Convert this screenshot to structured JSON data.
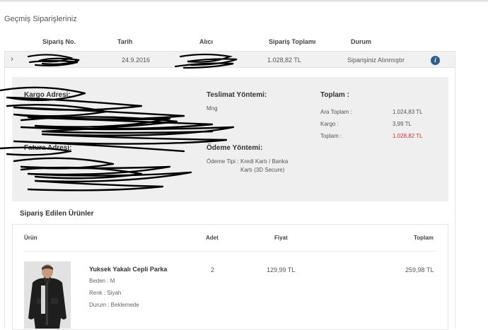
{
  "page": {
    "title": "Geçmiş Siparişleriniz"
  },
  "orders_table": {
    "headers": {
      "order_no": "Sipariş No.",
      "date": "Tarih",
      "recipient": "Alıcı",
      "order_total": "Sipariş Toplamı",
      "status": "Durum"
    },
    "row": {
      "date": "24.9.2016",
      "total": "1.028,82 TL",
      "status": "Siparişiniz Alınmıştır"
    }
  },
  "details": {
    "shipping_address_title": "Kargo Adresi:",
    "billing_address_title": "Fatura Adresi:",
    "delivery_method_title": "Teslimat Yöntemi:",
    "delivery_method_value": "Mng",
    "payment_method_title": "Ödeme Yöntemi:",
    "payment_type_label": "Ödeme Tipi :",
    "payment_type_value_1": "Kredi Kartı / Banka",
    "payment_type_value_2": "Kartı (3D Secure)",
    "totals": {
      "title": "Toplam :",
      "subtotal_label": "Ara Toplam :",
      "subtotal_value": "1.024,83 TL",
      "shipping_label": "Kargo :",
      "shipping_value": "3,99 TL",
      "total_label": "Toplam :",
      "total_value": "1.028,82 TL",
      "total_color": "#d9322c"
    }
  },
  "products": {
    "title": "Sipariş Edilen Ürünler",
    "headers": {
      "product": "Ürün",
      "quantity": "Adet",
      "price": "Fiyat",
      "total": "Toplam"
    },
    "item": {
      "name": "Yuksek Yakalı Cepli Parka",
      "size": "Beden : M",
      "color": "Renk : Siyah",
      "status": "Durum : Beklemede",
      "quantity": "2",
      "price": "129,99 TL",
      "total": "259,98 TL"
    }
  }
}
